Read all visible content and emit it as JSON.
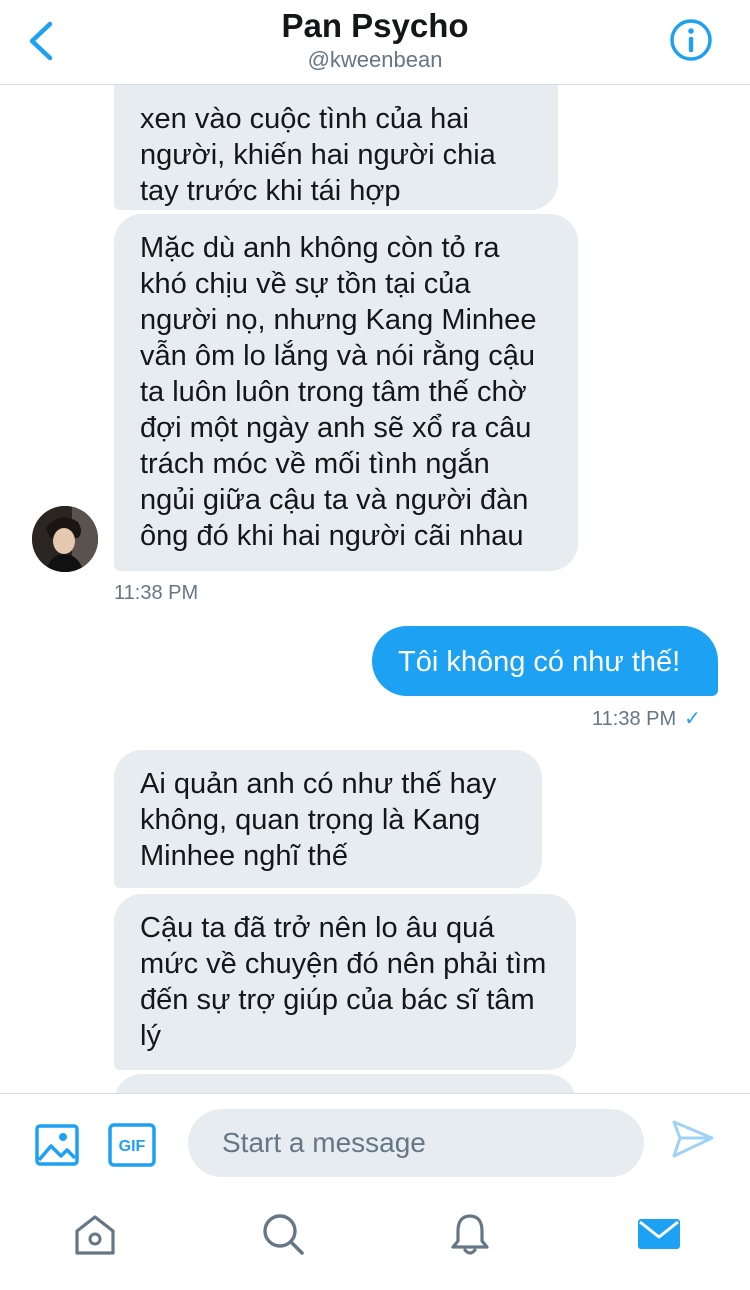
{
  "header": {
    "title": "Pan Psycho",
    "handle": "@kweenbean",
    "back_icon": "chevron-left-icon",
    "info_icon": "info-icon"
  },
  "messages": [
    {
      "from": "them",
      "text": "xen vào cuộc tình của hai người, khiến hai người chia tay trước khi tái hợp"
    },
    {
      "from": "them",
      "text": "Mặc dù anh không còn tỏ ra khó chịu về sự tồn tại của người nọ, nhưng Kang Minhee vẫn ôm lo lắng và nói rằng cậu ta luôn luôn trong tâm thế chờ đợi một ngày anh sẽ xổ ra câu trách móc về mối tình ngắn ngủi giữa cậu ta và người đàn ông đó khi hai người cãi nhau"
    },
    {
      "from": "me",
      "text": "Tôi không có như thế!"
    },
    {
      "from": "them",
      "text": "Ai quản anh có như thế hay không, quan trọng là Kang Minhee nghĩ thế"
    },
    {
      "from": "them",
      "text": "Cậu ta đã trở nên lo âu quá mức về chuyện đó nên phải tìm đến sự trợ giúp của bác sĩ tâm lý"
    }
  ],
  "timestamps": {
    "received": "11:38 PM",
    "sent": "11:38 PM"
  },
  "sent_status_icon": "✓",
  "composer": {
    "placeholder": "Start a message",
    "gif_label": "GIF",
    "media_icon": "image-icon",
    "send_icon": "send-icon"
  },
  "tabbar": {
    "icons": [
      "home-icon",
      "search-icon",
      "notifications-icon",
      "messages-icon"
    ],
    "active": "messages-icon"
  },
  "colors": {
    "accent": "#1da1f2",
    "bubble_received": "#e6ecf0",
    "secondary_text": "#657786"
  }
}
